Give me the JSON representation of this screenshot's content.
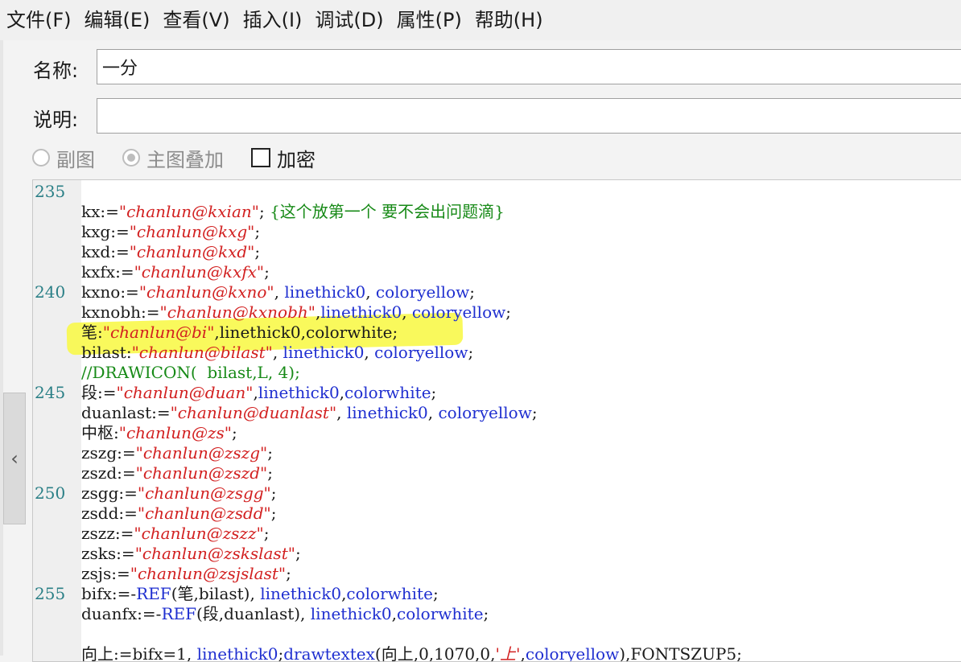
{
  "menu": [
    "文件(F)",
    "编辑(E)",
    "查看(V)",
    "插入(I)",
    "调试(D)",
    "属性(P)",
    "帮助(H)"
  ],
  "form": {
    "name_label": "名称:",
    "name_value": "一分",
    "desc_label": "说明:",
    "desc_value": ""
  },
  "options": {
    "sub_chart": "副图",
    "main_overlay": "主图叠加",
    "encrypt": "加密",
    "sub_chart_selected": false,
    "main_overlay_selected": true,
    "encrypt_checked": false
  },
  "colors": {
    "string": "#d22020",
    "keyword": "#1f2fd0",
    "comment": "#178a17",
    "line_number": "#2a7f86",
    "highlight": "#f8f84a"
  },
  "side_handle_icon": "chevron-left-icon",
  "editor": {
    "lines": [
      {
        "n": "235",
        "tokens": []
      },
      {
        "n": "",
        "tokens": [
          {
            "t": "kx:="
          },
          {
            "t": "\"chanlun@kxian\"",
            "c": "str"
          },
          {
            "t": "; "
          },
          {
            "t": "{这个放第一个 要不会出问题滴}",
            "c": "cmt"
          }
        ]
      },
      {
        "n": "",
        "tokens": [
          {
            "t": "kxg:="
          },
          {
            "t": "\"chanlun@kxg\"",
            "c": "str"
          },
          {
            "t": ";"
          }
        ]
      },
      {
        "n": "",
        "tokens": [
          {
            "t": "kxd:="
          },
          {
            "t": "\"chanlun@kxd\"",
            "c": "str"
          },
          {
            "t": ";"
          }
        ]
      },
      {
        "n": "",
        "tokens": [
          {
            "t": "kxfx:="
          },
          {
            "t": "\"chanlun@kxfx\"",
            "c": "str"
          },
          {
            "t": ";"
          }
        ]
      },
      {
        "n": "240",
        "tokens": [
          {
            "t": "kxno:="
          },
          {
            "t": "\"chanlun@kxno\"",
            "c": "str"
          },
          {
            "t": ", "
          },
          {
            "t": "linethick0",
            "c": "kw"
          },
          {
            "t": ", "
          },
          {
            "t": "coloryellow",
            "c": "kw"
          },
          {
            "t": ";"
          }
        ]
      },
      {
        "n": "",
        "tokens": [
          {
            "t": "kxnobh:="
          },
          {
            "t": "\"chanlun@kxnobh\"",
            "c": "str"
          },
          {
            "t": ","
          },
          {
            "t": "linethick0",
            "c": "kw"
          },
          {
            "t": ", "
          },
          {
            "t": "coloryellow",
            "c": "kw"
          },
          {
            "t": ";"
          }
        ]
      },
      {
        "n": "",
        "tokens": [
          {
            "t": "笔:"
          },
          {
            "t": "\"chanlun@bi\"",
            "c": "str"
          },
          {
            "t": ","
          },
          {
            "t": "linethick0"
          },
          {
            "t": ","
          },
          {
            "t": "colorwhite"
          },
          {
            "t": ";"
          }
        ]
      },
      {
        "n": "",
        "tokens": [
          {
            "t": "bilast:"
          },
          {
            "t": "\"chanlun@bilast\"",
            "c": "str"
          },
          {
            "t": ", "
          },
          {
            "t": "linethick0",
            "c": "kw"
          },
          {
            "t": ", "
          },
          {
            "t": "coloryellow",
            "c": "kw"
          },
          {
            "t": ";"
          }
        ]
      },
      {
        "n": "",
        "tokens": [
          {
            "t": "//DRAWICON(  bilast,L, 4);",
            "c": "cmt"
          }
        ]
      },
      {
        "n": "245",
        "tokens": [
          {
            "t": "段:="
          },
          {
            "t": "\"chanlun@duan\"",
            "c": "str"
          },
          {
            "t": ","
          },
          {
            "t": "linethick0",
            "c": "kw"
          },
          {
            "t": ","
          },
          {
            "t": "colorwhite",
            "c": "kw"
          },
          {
            "t": ";"
          }
        ]
      },
      {
        "n": "",
        "tokens": [
          {
            "t": "duanlast:="
          },
          {
            "t": "\"chanlun@duanlast\"",
            "c": "str"
          },
          {
            "t": ", "
          },
          {
            "t": "linethick0",
            "c": "kw"
          },
          {
            "t": ", "
          },
          {
            "t": "coloryellow",
            "c": "kw"
          },
          {
            "t": ";"
          }
        ]
      },
      {
        "n": "",
        "tokens": [
          {
            "t": "中枢:"
          },
          {
            "t": "\"chanlun@zs\"",
            "c": "str"
          },
          {
            "t": ";"
          }
        ]
      },
      {
        "n": "",
        "tokens": [
          {
            "t": "zszg:="
          },
          {
            "t": "\"chanlun@zszg\"",
            "c": "str"
          },
          {
            "t": ";"
          }
        ]
      },
      {
        "n": "",
        "tokens": [
          {
            "t": "zszd:="
          },
          {
            "t": "\"chanlun@zszd\"",
            "c": "str"
          },
          {
            "t": ";"
          }
        ]
      },
      {
        "n": "250",
        "tokens": [
          {
            "t": "zsgg:="
          },
          {
            "t": "\"chanlun@zsgg\"",
            "c": "str"
          },
          {
            "t": ";"
          }
        ]
      },
      {
        "n": "",
        "tokens": [
          {
            "t": "zsdd:="
          },
          {
            "t": "\"chanlun@zsdd\"",
            "c": "str"
          },
          {
            "t": ";"
          }
        ]
      },
      {
        "n": "",
        "tokens": [
          {
            "t": "zszz:="
          },
          {
            "t": "\"chanlun@zszz\"",
            "c": "str"
          },
          {
            "t": ";"
          }
        ]
      },
      {
        "n": "",
        "tokens": [
          {
            "t": "zsks:="
          },
          {
            "t": "\"chanlun@zskslast\"",
            "c": "str"
          },
          {
            "t": ";"
          }
        ]
      },
      {
        "n": "",
        "tokens": [
          {
            "t": "zsjs:="
          },
          {
            "t": "\"chanlun@zsjslast\"",
            "c": "str"
          },
          {
            "t": ";"
          }
        ]
      },
      {
        "n": "255",
        "tokens": [
          {
            "t": "bifx:=-"
          },
          {
            "t": "REF",
            "c": "kw"
          },
          {
            "t": "(笔,bilast), "
          },
          {
            "t": "linethick0",
            "c": "kw"
          },
          {
            "t": ","
          },
          {
            "t": "colorwhite",
            "c": "kw"
          },
          {
            "t": ";"
          }
        ]
      },
      {
        "n": "",
        "tokens": [
          {
            "t": "duanfx:=-"
          },
          {
            "t": "REF",
            "c": "kw"
          },
          {
            "t": "(段,duanlast), "
          },
          {
            "t": "linethick0",
            "c": "kw"
          },
          {
            "t": ","
          },
          {
            "t": "colorwhite",
            "c": "kw"
          },
          {
            "t": ";"
          }
        ]
      },
      {
        "n": "",
        "tokens": []
      },
      {
        "n": "",
        "tokens": [
          {
            "t": "向上:=bifx=1, "
          },
          {
            "t": "linethick0",
            "c": "kw"
          },
          {
            "t": ";"
          },
          {
            "t": "drawtextex",
            "c": "kw"
          },
          {
            "t": "(向上,0,1070,0,"
          },
          {
            "t": "'上'",
            "c": "str"
          },
          {
            "t": ","
          },
          {
            "t": "coloryellow",
            "c": "kw"
          },
          {
            "t": "),FONTSZUP5;"
          }
        ]
      }
    ]
  }
}
